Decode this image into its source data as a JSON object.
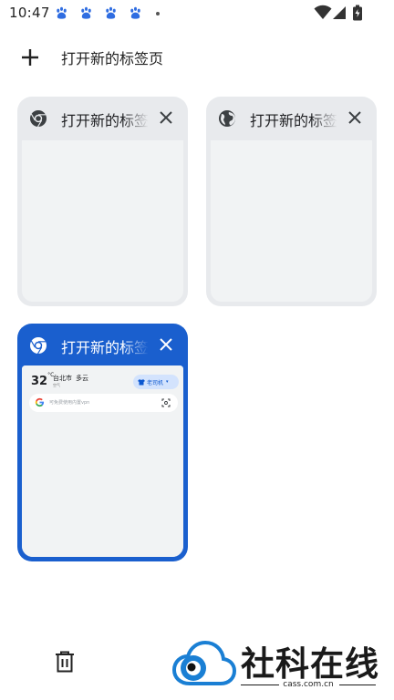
{
  "status_bar": {
    "time": "10:47",
    "notifications": [
      "baidu-paw-icon",
      "baidu-paw-icon",
      "baidu-paw-icon",
      "baidu-paw-icon"
    ],
    "system_icons": [
      "wifi-icon",
      "signal-icon",
      "battery-icon"
    ]
  },
  "new_tab": {
    "label": "打开新的标签页"
  },
  "tabs": [
    {
      "title": "打开新的标签页",
      "favicon": "chrome-icon",
      "active": false
    },
    {
      "title": "打开新的标签页",
      "favicon": "globe-icon",
      "active": false
    },
    {
      "title": "打开新的标签页",
      "favicon": "chrome-icon",
      "active": true
    }
  ],
  "preview": {
    "temperature": "32",
    "temp_unit": "°C",
    "city": "台北市",
    "condition": "多云",
    "condition_sub": "空气",
    "account_pill": "老司机",
    "search_placeholder": "可免费使用内置vpn"
  },
  "watermark": {
    "text": "社科在线",
    "domain": "cass.com.cn"
  },
  "colors": {
    "active_tab": "#1a5fce",
    "inactive_tab": "#e8eaed",
    "tab_body": "#f1f3f4"
  }
}
